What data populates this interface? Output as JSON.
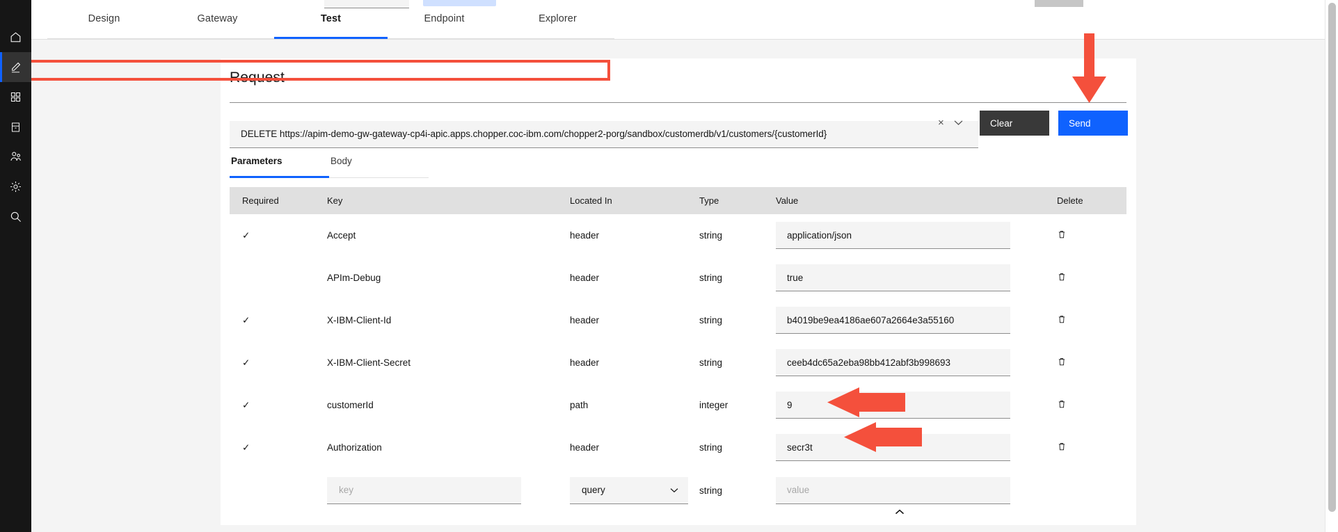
{
  "sidebar": {
    "items": [
      {
        "name": "home",
        "icon": "home-icon",
        "active": false
      },
      {
        "name": "design",
        "icon": "pencil-icon",
        "active": true
      },
      {
        "name": "products",
        "icon": "grid-icon",
        "active": false
      },
      {
        "name": "catalogs",
        "icon": "server-icon",
        "active": false
      },
      {
        "name": "members",
        "icon": "users-icon",
        "active": false
      },
      {
        "name": "settings",
        "icon": "gear-icon",
        "active": false
      },
      {
        "name": "search",
        "icon": "search-icon",
        "active": false
      }
    ]
  },
  "tabs": [
    {
      "label": "Design",
      "active": false
    },
    {
      "label": "Gateway",
      "active": false
    },
    {
      "label": "Test",
      "active": true
    },
    {
      "label": "Endpoint",
      "active": false
    },
    {
      "label": "Explorer",
      "active": false
    }
  ],
  "request": {
    "title": "Request",
    "url_value": "DELETE https://apim-demo-gw-gateway-cp4i-apic.apps.chopper.coc-ibm.com/chopper2-porg/sandbox/customerdb/v1/customers/{customerId}",
    "clear_x_label": "×",
    "chevron_label": "⌄",
    "clear_label": "Clear",
    "send_label": "Send",
    "highlight_color": "#f4503c",
    "send_color": "#0f62fe",
    "clear_color": "#393939"
  },
  "subtabs": [
    {
      "label": "Parameters",
      "active": true
    },
    {
      "label": "Body",
      "active": false
    }
  ],
  "table": {
    "columns": [
      "Required",
      "Key",
      "Located In",
      "Type",
      "Value",
      "Delete"
    ],
    "rows": [
      {
        "required": "✓",
        "key": "Accept",
        "located_in": "header",
        "type": "string",
        "value": "application/json"
      },
      {
        "required": "",
        "key": "APIm-Debug",
        "located_in": "header",
        "type": "string",
        "value": "true"
      },
      {
        "required": "✓",
        "key": "X-IBM-Client-Id",
        "located_in": "header",
        "type": "string",
        "value": "b4019be9ea4186ae607a2664e3a55160"
      },
      {
        "required": "✓",
        "key": "X-IBM-Client-Secret",
        "located_in": "header",
        "type": "string",
        "value": "ceeb4dc65a2eba98bb412abf3b998693"
      },
      {
        "required": "✓",
        "key": "customerId",
        "located_in": "path",
        "type": "integer",
        "value": "9"
      },
      {
        "required": "✓",
        "key": "Authorization",
        "located_in": "header",
        "type": "string",
        "value": "secr3t"
      }
    ],
    "new_row": {
      "key_placeholder": "key",
      "located_in_selected": "query",
      "type": "string",
      "value_placeholder": "value"
    }
  },
  "annotations": {
    "arrow_color": "#f4503c",
    "arrows": [
      {
        "name": "arrow-pointing-to-send",
        "direction": "down"
      },
      {
        "name": "arrow-pointing-to-customerid",
        "direction": "left"
      },
      {
        "name": "arrow-pointing-to-authorization",
        "direction": "left"
      }
    ]
  }
}
